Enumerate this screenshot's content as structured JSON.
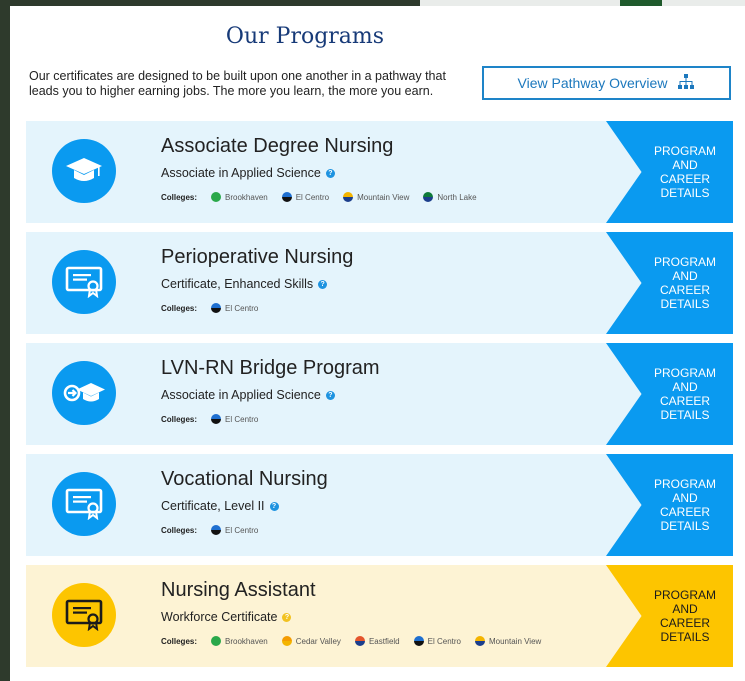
{
  "page": {
    "title": "Our Programs",
    "intro": "Our certificates are designed to be built upon one another in a pathway that leads you to higher earning jobs. The more you learn, the more you earn.",
    "pathway_button": "View Pathway Overview",
    "colleges_label": "Colleges:",
    "details_label": "PROGRAM\nAND\nCAREER\nDETAILS"
  },
  "colors": {
    "blue_accent": "#0a9af0",
    "yellow_accent": "#fdc500",
    "title_navy": "#173a78",
    "blue_row_bg": "#e4f4fc",
    "yellow_row_bg": "#fdf3d4"
  },
  "college_colors": {
    "Brookhaven": [
      "#2aa84a",
      "#2aa84a"
    ],
    "El Centro": [
      "#1e6fd0",
      "#111111"
    ],
    "Mountain View": [
      "#f4b400",
      "#1b3e8c"
    ],
    "North Lake": [
      "#0e7a3a",
      "#1b3e8c"
    ],
    "Cedar Valley": [
      "#f49b00",
      "#f4b400"
    ],
    "Eastfield": [
      "#e4542c",
      "#1b3e8c"
    ]
  },
  "programs": [
    {
      "name": "Associate Degree Nursing",
      "credential": "Associate in Applied Science",
      "icon": "graduation-cap-icon",
      "theme": "blue",
      "colleges": [
        "Brookhaven",
        "El Centro",
        "Mountain View",
        "North Lake"
      ]
    },
    {
      "name": "Perioperative Nursing",
      "credential": "Certificate, Enhanced Skills",
      "icon": "certificate-icon",
      "theme": "blue",
      "colleges": [
        "El Centro"
      ]
    },
    {
      "name": "LVN-RN Bridge Program",
      "credential": "Associate in Applied Science",
      "icon": "bridge-cap-icon",
      "theme": "blue",
      "colleges": [
        "El Centro"
      ]
    },
    {
      "name": "Vocational Nursing",
      "credential": "Certificate, Level II",
      "icon": "certificate-icon",
      "theme": "blue",
      "colleges": [
        "El Centro"
      ]
    },
    {
      "name": "Nursing Assistant",
      "credential": "Workforce Certificate",
      "icon": "certificate-icon",
      "theme": "yellow",
      "colleges": [
        "Brookhaven",
        "Cedar Valley",
        "Eastfield",
        "El Centro",
        "Mountain View"
      ]
    }
  ]
}
